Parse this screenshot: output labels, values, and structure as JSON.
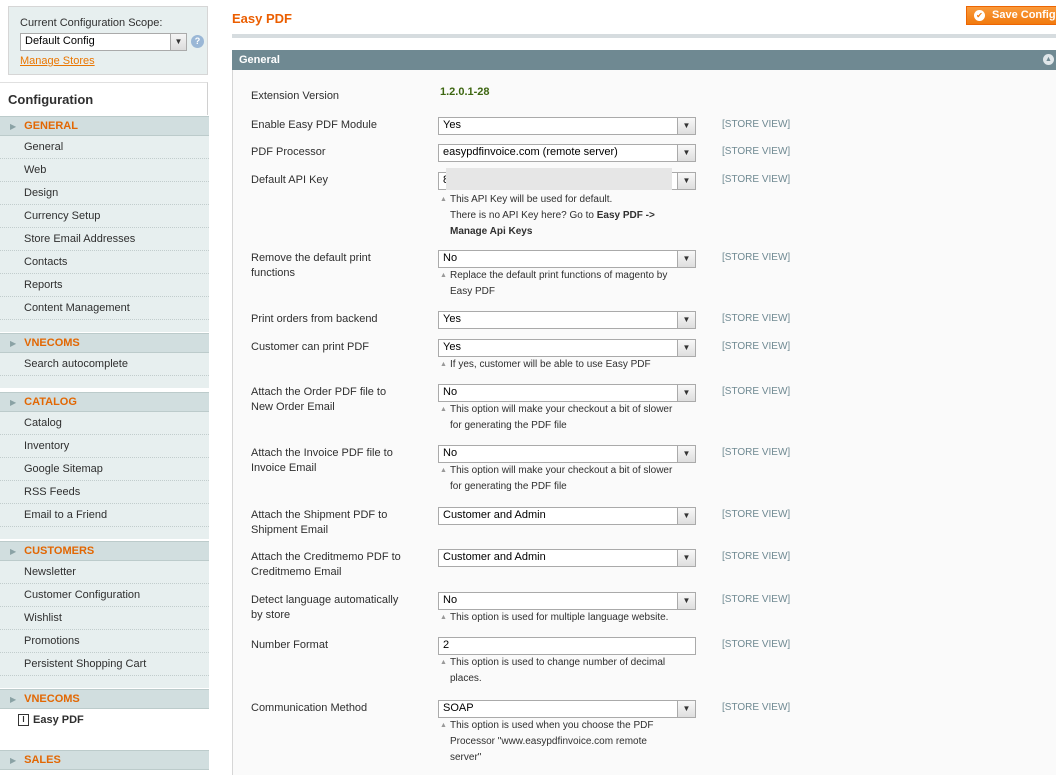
{
  "sidebar": {
    "scope_label": "Current Configuration Scope:",
    "scope_value": "Default Config",
    "manage_stores": "Manage Stores",
    "config_title": "Configuration",
    "sections": [
      {
        "header": "GENERAL",
        "items": [
          "General",
          "Web",
          "Design",
          "Currency Setup",
          "Store Email Addresses",
          "Contacts",
          "Reports",
          "Content Management"
        ]
      },
      {
        "header": "VNECOMS",
        "items": [
          "Search autocomplete"
        ]
      },
      {
        "header": "CATALOG",
        "items": [
          "Catalog",
          "Inventory",
          "Google Sitemap",
          "RSS Feeds",
          "Email to a Friend"
        ]
      },
      {
        "header": "CUSTOMERS",
        "items": [
          "Newsletter",
          "Customer Configuration",
          "Wishlist",
          "Promotions",
          "Persistent Shopping Cart"
        ]
      },
      {
        "header": "VNECOMS",
        "items": [
          "Easy PDF"
        ]
      },
      {
        "header": "SALES",
        "items": []
      }
    ]
  },
  "main": {
    "page_title": "Easy PDF",
    "save_button": "Save Config",
    "fieldset_title": "General",
    "rows": {
      "ext_version": {
        "label": "Extension Version",
        "value": "1.2.0.1-28"
      },
      "enable": {
        "label": "Enable Easy PDF Module",
        "value": "Yes",
        "scope": "[STORE VIEW]"
      },
      "processor": {
        "label": "PDF Processor",
        "value": "easypdfinvoice.com (remote server)",
        "scope": "[STORE VIEW]"
      },
      "api_key": {
        "label": "Default API Key",
        "value": "8",
        "scope": "[STORE VIEW]",
        "note_line1": "This API Key will be used for default.",
        "note_line2": "There is no API Key here? Go to ",
        "note_bold1": "Easy PDF ->",
        "note_bold2": "Manage Api Keys"
      },
      "remove_print": {
        "label_1": "Remove the default print",
        "label_2": "functions",
        "value": "No",
        "scope": "[STORE VIEW]",
        "note_1": "Replace the default print functions of magento by",
        "note_2": "Easy PDF"
      },
      "print_backend": {
        "label": "Print orders from backend",
        "value": "Yes",
        "scope": "[STORE VIEW]"
      },
      "customer_print": {
        "label": "Customer can print PDF",
        "value": "Yes",
        "scope": "[STORE VIEW]",
        "note": "If yes, customer will be able to use Easy PDF"
      },
      "order_pdf": {
        "label_1": "Attach the Order PDF file to",
        "label_2": "New Order Email",
        "value": "No",
        "scope": "[STORE VIEW]",
        "note_1": "This option will make your checkout a bit of slower",
        "note_2": "for generating the PDF file"
      },
      "invoice_pdf": {
        "label_1": "Attach the Invoice PDF file to",
        "label_2": "Invoice Email",
        "value": "No",
        "scope": "[STORE VIEW]",
        "note_1": "This option will make your checkout a bit of slower",
        "note_2": "for generating the PDF file"
      },
      "shipment_pdf": {
        "label_1": "Attach the Shipment PDF to",
        "label_2": "Shipment Email",
        "value": "Customer and Admin",
        "scope": "[STORE VIEW]"
      },
      "creditmemo_pdf": {
        "label_1": "Attach the Creditmemo PDF to",
        "label_2": "Creditmemo Email",
        "value": "Customer and Admin",
        "scope": "[STORE VIEW]"
      },
      "detect_lang": {
        "label_1": "Detect language automatically",
        "label_2": "by store",
        "value": "No",
        "scope": "[STORE VIEW]",
        "note": "This option is used for multiple language website."
      },
      "number_format": {
        "label": "Number Format",
        "value": "2",
        "scope": "[STORE VIEW]",
        "note_1": "This option is used to change number of decimal",
        "note_2": "places."
      },
      "comm_method": {
        "label": "Communication Method",
        "value": "SOAP",
        "scope": "[STORE VIEW]",
        "note_1": "This option is used when you choose the PDF",
        "note_2": "Processor \"www.easypdfinvoice.com remote",
        "note_3": "server\""
      }
    }
  },
  "colors": {
    "accent": "#eb5e00",
    "header_bg": "#6f8992",
    "sidebar_bg": "#e7efef",
    "version_green": "#3d6611"
  },
  "icons": {
    "dropdown": "chevron-down-icon",
    "help": "help-icon",
    "collapse": "collapse-icon",
    "save": "check-icon"
  }
}
